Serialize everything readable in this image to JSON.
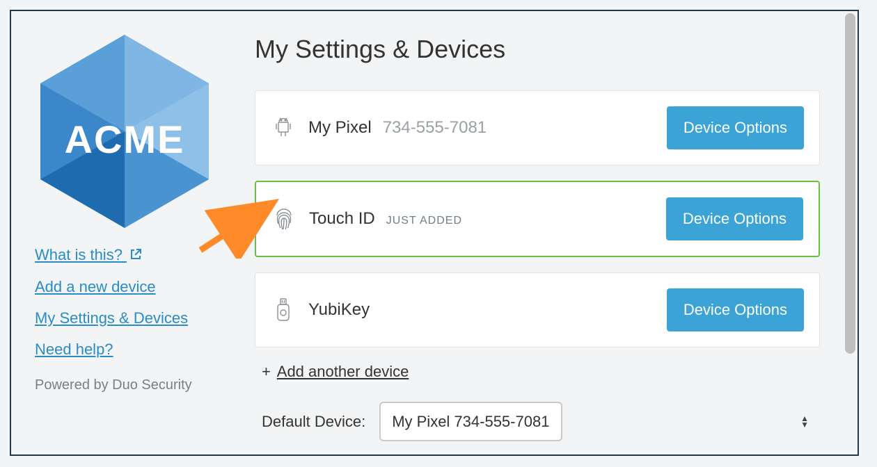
{
  "brand": {
    "name": "ACME"
  },
  "sidebar": {
    "links": {
      "what_is_this": "What is this?",
      "add_device": "Add a new device",
      "my_settings": "My Settings & Devices",
      "need_help": "Need help?"
    },
    "powered_by": "Powered by Duo Security"
  },
  "main": {
    "title": "My Settings & Devices",
    "devices": [
      {
        "name": "My Pixel",
        "sub": "734-555-7081",
        "badge": "",
        "button": "Device Options"
      },
      {
        "name": "Touch ID",
        "sub": "",
        "badge": "JUST ADDED",
        "button": "Device Options"
      },
      {
        "name": "YubiKey",
        "sub": "",
        "badge": "",
        "button": "Device Options"
      }
    ],
    "add_another_label": "Add another device",
    "default_device_label": "Default Device:",
    "default_device_selected": "My Pixel 734-555-7081"
  }
}
